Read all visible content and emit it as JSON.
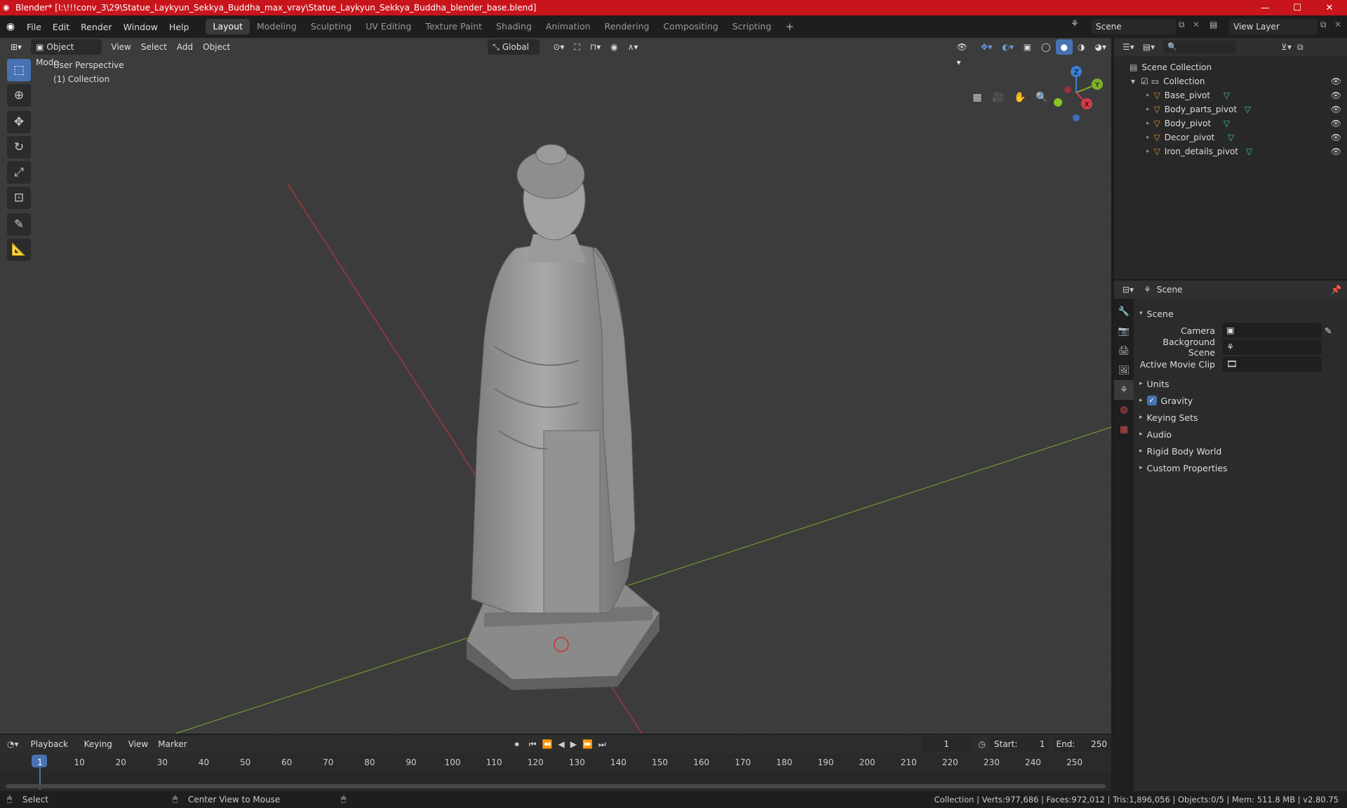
{
  "window": {
    "title": "Blender* [I:\\!!!conv_3\\29\\Statue_Laykyun_Sekkya_Buddha_max_vray\\Statue_Laykyun_Sekkya_Buddha_blender_base.blend]",
    "controls": {
      "minimize": "—",
      "maximize": "☐",
      "close": "✕"
    }
  },
  "menu": {
    "items": [
      "File",
      "Edit",
      "Render",
      "Window",
      "Help"
    ],
    "workspaces": [
      "Layout",
      "Modeling",
      "Sculpting",
      "UV Editing",
      "Texture Paint",
      "Shading",
      "Animation",
      "Rendering",
      "Compositing",
      "Scripting"
    ],
    "active_workspace": "Layout",
    "add_workspace": "+",
    "scene_name": "Scene",
    "view_layer": "View Layer"
  },
  "viewport": {
    "mode": "Object Mode",
    "menus": [
      "View",
      "Select",
      "Add",
      "Object"
    ],
    "orientation": "Global",
    "overlay_line1": "User Perspective",
    "overlay_line2": "(1) Collection",
    "gizmo_axes": {
      "z": "Z",
      "y": "Y",
      "x": "X"
    },
    "accent": "#4772b3"
  },
  "outliner": {
    "root": "Scene Collection",
    "collection": "Collection",
    "objects": [
      "Base_pivot",
      "Body_parts_pivot",
      "Body_pivot",
      "Decor_pivot",
      "Iron_details_pivot"
    ],
    "search_placeholder": ""
  },
  "properties": {
    "header": "Scene",
    "panel_title": "Scene",
    "fields": [
      {
        "label": "Camera",
        "value": ""
      },
      {
        "label": "Background Scene",
        "value": ""
      },
      {
        "label": "Active Movie Clip",
        "value": ""
      }
    ],
    "sections": [
      "Units",
      "Gravity",
      "Keying Sets",
      "Audio",
      "Rigid Body World",
      "Custom Properties"
    ],
    "gravity_checked": true
  },
  "timeline": {
    "menus": [
      "Playback",
      "Keying",
      "View",
      "Marker"
    ],
    "current_frame": "1",
    "start_label": "Start:",
    "start_value": "1",
    "end_label": "End:",
    "end_value": "250",
    "ticks": [
      "1",
      "10",
      "20",
      "30",
      "40",
      "50",
      "60",
      "70",
      "80",
      "90",
      "100",
      "110",
      "120",
      "130",
      "140",
      "150",
      "160",
      "170",
      "180",
      "190",
      "200",
      "210",
      "220",
      "230",
      "240",
      "250"
    ]
  },
  "statusbar": {
    "left_action": "Select",
    "middle_action": "Center View to Mouse",
    "stats": "Collection | Verts:977,686 | Faces:972,012 | Tris:1,896,056 | Objects:0/5 | Mem: 511.8 MB | v2.80.75"
  }
}
